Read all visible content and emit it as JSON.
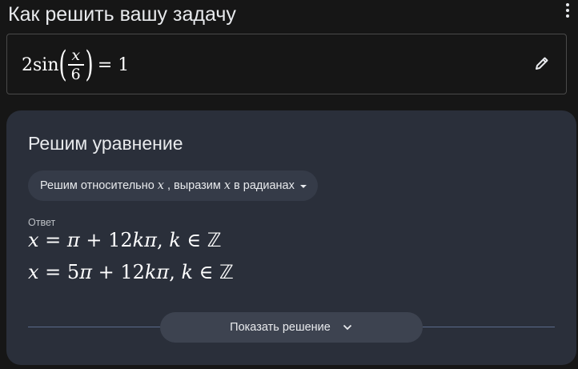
{
  "header": {
    "title": "Как решить вашу задачу",
    "more_icon": "more-vert-icon"
  },
  "equation": {
    "coefficient": "2sin",
    "fraction_numerator": "x",
    "fraction_denominator": "6",
    "rhs": "= 1",
    "edit_icon": "pencil-icon"
  },
  "card": {
    "title": "Решим уравнение",
    "chip": {
      "text_before": "Решим относительно",
      "var1": "x",
      "text_middle": ", выразим",
      "var2": "x",
      "text_after": "в радианах"
    },
    "answer_label": "Ответ",
    "answers": [
      "x = π + 12kπ, k ∈ ℤ",
      "x = 5π + 12kπ, k ∈ ℤ"
    ],
    "show_solution_label": "Показать решение"
  },
  "colors": {
    "background": "#161616",
    "card": "#2a2f3a",
    "chip": "#353b48",
    "button": "#3d4350",
    "divider": "#5a6a8a"
  }
}
